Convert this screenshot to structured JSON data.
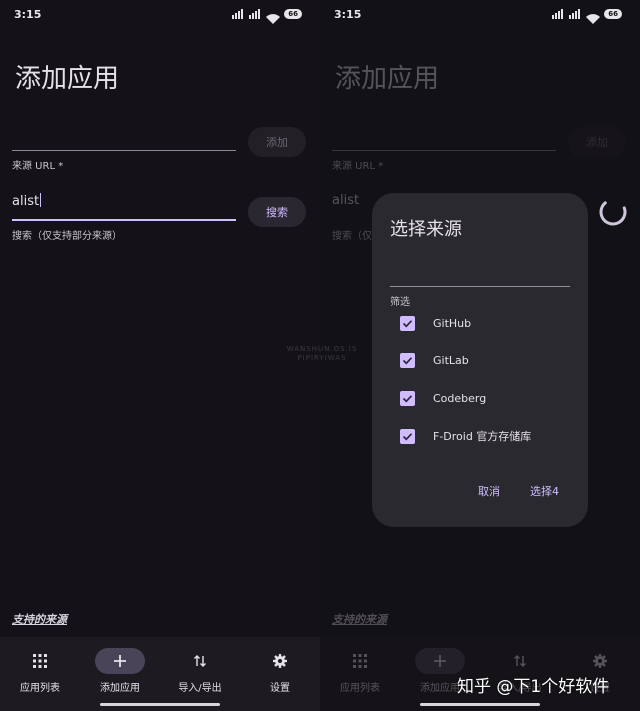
{
  "status_bar": {
    "time": "3:15",
    "battery": "66"
  },
  "page": {
    "title": "添加应用"
  },
  "url_field": {
    "label": "来源 URL *",
    "value": ""
  },
  "add_button": {
    "label": "添加"
  },
  "search_field": {
    "label": "搜索（仅支持部分来源）",
    "value": "alist"
  },
  "search_button": {
    "label": "搜索"
  },
  "supported_sources_link": "支持的来源",
  "nav": {
    "items": [
      {
        "label": "应用列表",
        "icon": "grid-icon"
      },
      {
        "label": "添加应用",
        "icon": "plus-icon"
      },
      {
        "label": "导入/导出",
        "icon": "swap-vertical-icon"
      },
      {
        "label": "设置",
        "icon": "gear-icon"
      }
    ],
    "active_index": 1
  },
  "dialog": {
    "title": "选择来源",
    "filter_label": "筛选",
    "options": [
      {
        "label": "GitHub",
        "checked": true
      },
      {
        "label": "GitLab",
        "checked": true
      },
      {
        "label": "Codeberg",
        "checked": true
      },
      {
        "label": "F-Droid 官方存储库",
        "checked": true
      }
    ],
    "cancel_label": "取消",
    "confirm_label": "选择4"
  },
  "watermark": {
    "line1": "WANSHUN.OS.IS",
    "line2": "PIPIRYIWAS"
  },
  "source_watermark": "知乎 @下1个好软件",
  "colors": {
    "accent": "#d0bcff",
    "background": "#141218",
    "dialog": "#2b2930"
  }
}
